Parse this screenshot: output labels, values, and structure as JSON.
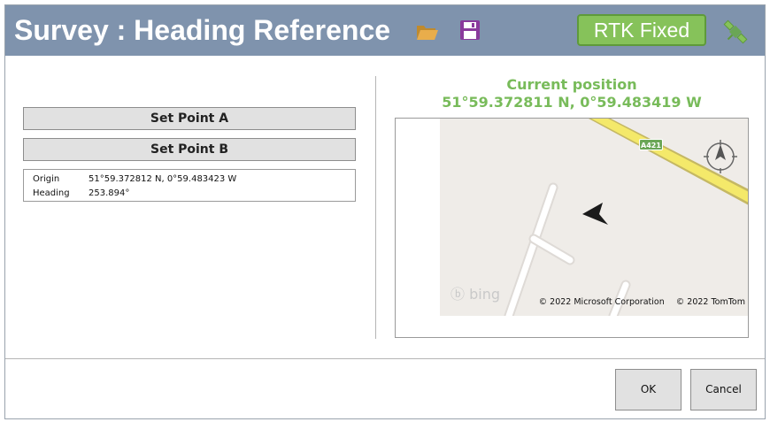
{
  "title": "Survey : Heading Reference",
  "status": {
    "label": "RTK Fixed",
    "color": "#86c25a"
  },
  "icons": {
    "open": "folder-icon",
    "save": "save-icon",
    "gnss": "satellite-icon",
    "compass": "compass-icon",
    "heading": "heading-arrow-icon"
  },
  "buttons": {
    "set_a": "Set Point A",
    "set_b": "Set Point B",
    "ok": "OK",
    "cancel": "Cancel"
  },
  "info": {
    "origin_label": "Origin",
    "origin_value": "51°59.372812 N, 0°59.483423 W",
    "heading_label": "Heading",
    "heading_value": "253.894°"
  },
  "current_position": {
    "label": "Current position",
    "value": "51°59.372811 N, 0°59.483419 W"
  },
  "map": {
    "road_label": "A421",
    "brand": "bing",
    "copyright_ms": "© 2022 Microsoft Corporation",
    "copyright_tomtom": "© 2022 TomTom"
  },
  "colors": {
    "titlebar": "#7f93ad",
    "accent": "#78bb5a"
  }
}
